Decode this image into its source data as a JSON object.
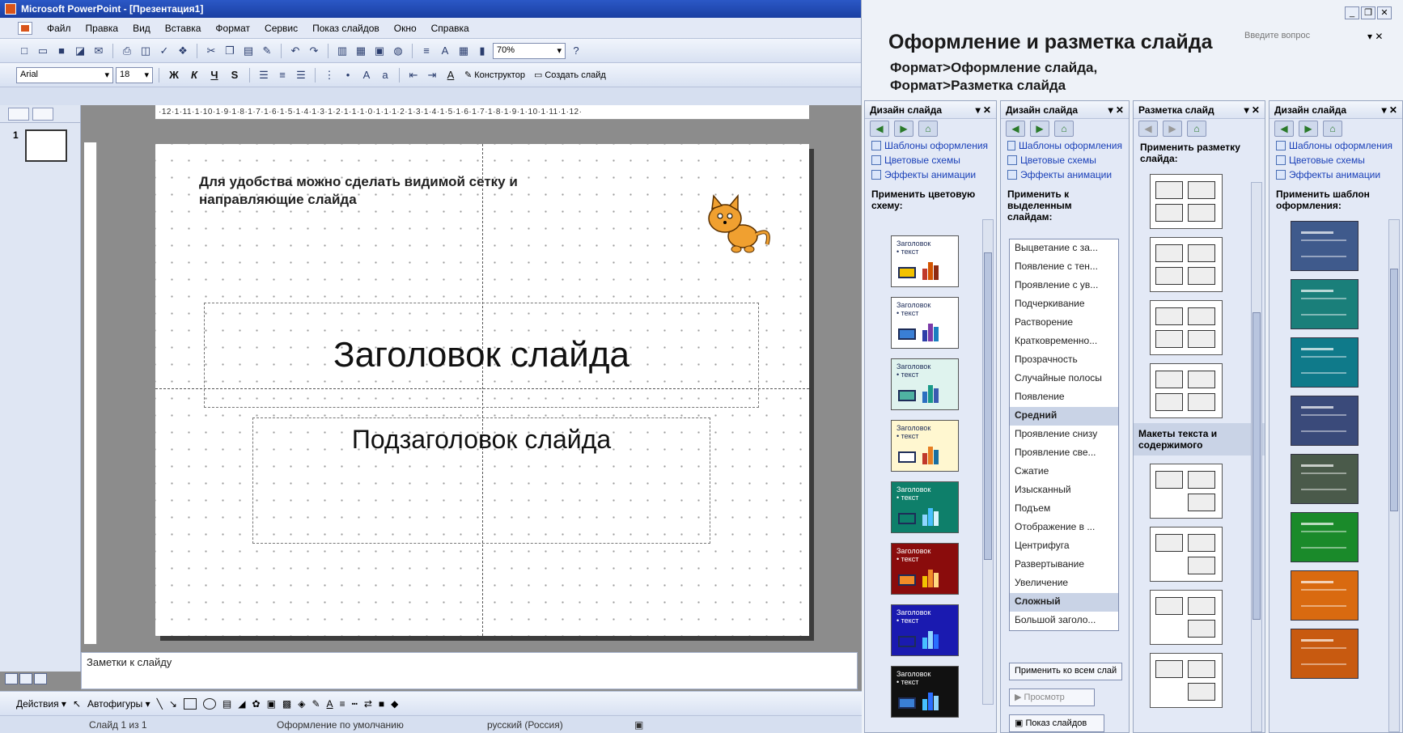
{
  "window": {
    "title": "Microsoft PowerPoint - [Презентация1]"
  },
  "menu": [
    "Файл",
    "Правка",
    "Вид",
    "Вставка",
    "Формат",
    "Сервис",
    "Показ слайдов",
    "Окно",
    "Справка"
  ],
  "toolbar": {
    "zoom": "70%"
  },
  "format_toolbar": {
    "font": "Arial",
    "size": "18",
    "bold": "Ж",
    "italic": "К",
    "underline": "Ч",
    "shadow": "S",
    "designer_label": "Конструктор",
    "new_slide_label": "Создать слайд"
  },
  "ruler": {
    "horizontal": "·12·1·11·1·10·1·9·1·8·1·7·1·6·1·5·1·4·1·3·1·2·1·1·1·0·1·1·1·2·1·3·1·4·1·5·1·6·1·7·1·8·1·9·1·10·1·11·1·12·"
  },
  "thumbnails": {
    "slide_number": "1"
  },
  "slide": {
    "note": "Для удобства можно сделать видимой сетку и направляющие слайда",
    "title": "Заголовок слайда",
    "subtitle": "Подзаголовок слайда"
  },
  "notes": {
    "text": "Заметки к слайду"
  },
  "drawing": {
    "actions": "Действия ▾",
    "autoshapes": "Автофигуры ▾"
  },
  "status": {
    "slide": "Слайд 1 из 1",
    "design": "Оформление по умолчанию",
    "language": "русский (Россия)"
  },
  "heading": {
    "title": "Оформление и разметка слайда",
    "line1": "Формат>Оформление слайда,",
    "line2": "Формат>Разметка слайда"
  },
  "help": {
    "ask": "Введите вопрос"
  },
  "pane_colors": {
    "title": "Дизайн слайда",
    "links": [
      "Шаблоны оформления",
      "Цветовые схемы",
      "Эффекты анимации"
    ],
    "label": "Применить цветовую схему:",
    "scheme_title": "Заголовок",
    "scheme_text": "• текст",
    "schemes": [
      {
        "bg": "#ffffff",
        "text": "#1d2c58",
        "shape": "#f2c200",
        "bars": [
          "#c0392b",
          "#d35400",
          "#8e2a10"
        ]
      },
      {
        "bg": "#ffffff",
        "text": "#1d2c58",
        "shape": "#3a7fd5",
        "bars": [
          "#2d3fa8",
          "#7c3aa8",
          "#1a7fc0"
        ]
      },
      {
        "bg": "#dff3ee",
        "text": "#1d2c58",
        "shape": "#4fb2a2",
        "bars": [
          "#2a6fc0",
          "#1a9a88",
          "#3a5ab0"
        ]
      },
      {
        "bg": "#fff7d0",
        "text": "#1d2c58",
        "shape": "#ffffff",
        "bars": [
          "#c0392b",
          "#e67e22",
          "#1a6fa0"
        ]
      },
      {
        "bg": "#0e7f6a",
        "text": "#ffffff",
        "shape": "#0e7f6a",
        "bars": [
          "#8fd6ff",
          "#47c0ff",
          "#d8f4ff"
        ]
      },
      {
        "bg": "#8a0c0c",
        "text": "#ffffff",
        "shape": "#f28c28",
        "bars": [
          "#f2c200",
          "#f28c28",
          "#ffd980"
        ]
      },
      {
        "bg": "#1a1ab0",
        "text": "#ffffff",
        "shape": "#1a1ab0",
        "bars": [
          "#47c0ff",
          "#8fd6ff",
          "#2a6fff"
        ]
      },
      {
        "bg": "#111111",
        "text": "#ffffff",
        "shape": "#3a7fd5",
        "bars": [
          "#47c0ff",
          "#2a6fff",
          "#8fd6ff"
        ]
      }
    ]
  },
  "pane_animation": {
    "title": "Дизайн слайда",
    "links": [
      "Шаблоны оформления",
      "Цветовые схемы",
      "Эффекты анимации"
    ],
    "label": "Применить к выделенным слайдам:",
    "effects": [
      {
        "name": "Выцветание с за...",
        "group": false
      },
      {
        "name": "Появление с тен...",
        "group": false
      },
      {
        "name": "Проявление с ув...",
        "group": false
      },
      {
        "name": "Подчеркивание",
        "group": false
      },
      {
        "name": "Растворение",
        "group": false
      },
      {
        "name": "Кратковременно...",
        "group": false
      },
      {
        "name": "Прозрачность",
        "group": false
      },
      {
        "name": "Случайные полосы",
        "group": false
      },
      {
        "name": "Появление",
        "group": false
      },
      {
        "name": "Средний",
        "group": true
      },
      {
        "name": "Проявление снизу",
        "group": false
      },
      {
        "name": "Проявление све...",
        "group": false
      },
      {
        "name": "Сжатие",
        "group": false
      },
      {
        "name": "Изысканный",
        "group": false
      },
      {
        "name": "Подъем",
        "group": false
      },
      {
        "name": "Отображение в ...",
        "group": false
      },
      {
        "name": "Центрифуга",
        "group": false
      },
      {
        "name": "Развертывание",
        "group": false
      },
      {
        "name": "Увеличение",
        "group": false
      },
      {
        "name": "Сложный",
        "group": true
      },
      {
        "name": "Большой заголо...",
        "group": false
      }
    ],
    "apply_all": "Применить ко всем слай",
    "preview": "Просмотр",
    "show": "Показ слайдов"
  },
  "pane_layout": {
    "title": "Разметка слайд",
    "label": "Применить разметку слайда:",
    "section": "Макеты текста и содержимого"
  },
  "pane_design": {
    "title": "Дизайн слайда",
    "links": [
      "Шаблоны оформления",
      "Цветовые схемы",
      "Эффекты анимации"
    ],
    "label": "Применить шаблон оформления:",
    "templates": [
      "#3f5a8c",
      "#1a7f7a",
      "#0f7a8a",
      "#3a4a7a",
      "#4a5a4a",
      "#1a8a2a",
      "#d96a10",
      "#c85a10"
    ]
  }
}
